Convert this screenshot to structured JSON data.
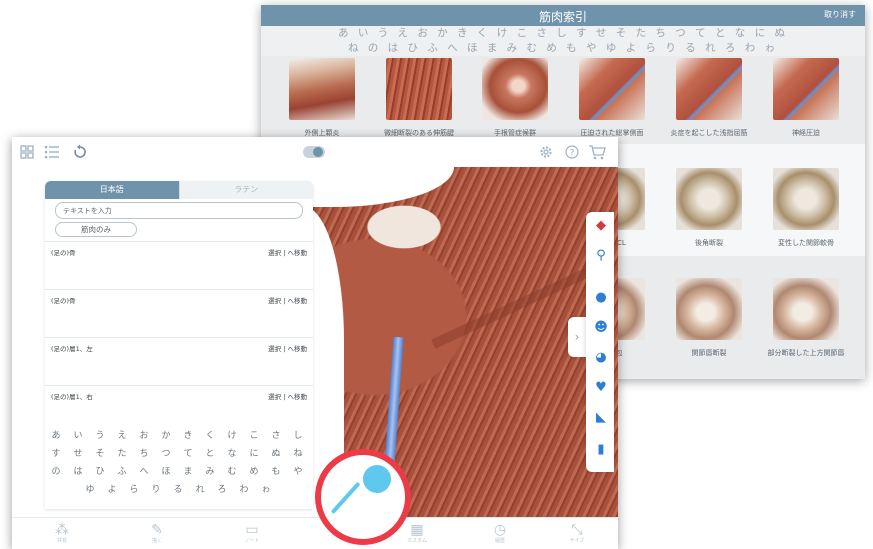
{
  "index_window": {
    "title": "筋肉索引",
    "cancel_label": "取り消す",
    "kana_row1": "あ い う え お か き く け こ さ し す せ そ た ち つ て と な に ぬ",
    "kana_row2": "ね の は ひ ふ へ ほ ま み む め も や ゆ よ ら り る れ ろ わ ゎ",
    "thumbnails": [
      {
        "caption": "外側上顆炎",
        "icon": "forearm-muscle-image"
      },
      {
        "caption": "微細断裂のある伸筋腱",
        "icon": "extensor-tendon-image"
      },
      {
        "caption": "手根管症候群",
        "icon": "hand-image"
      },
      {
        "caption": "圧迫された総掌側面",
        "icon": "forearm-nerve-image"
      },
      {
        "caption": "炎症を起こした浅指屈筋",
        "icon": "forearm-nerve-image"
      },
      {
        "caption": "神経圧迫",
        "icon": "forearm-nerve-image"
      },
      {
        "caption": "したACL",
        "icon": "knee-joint-image"
      },
      {
        "caption": "後角断裂",
        "icon": "knee-joint-image"
      },
      {
        "caption": "変性した関節軟骨",
        "icon": "knee-joint-image"
      },
      {
        "caption": "関節包",
        "icon": "shoulder-joint-image"
      },
      {
        "caption": "関節唇断裂",
        "icon": "shoulder-joint-image"
      },
      {
        "caption": "部分断裂した上方関節唇",
        "icon": "shoulder-joint-image"
      }
    ]
  },
  "app": {
    "top_icons": [
      "grid-icon",
      "list-icon",
      "reset-icon",
      "toggle-icon",
      "settings-icon",
      "help-icon",
      "cart-icon"
    ],
    "panel": {
      "tab_japanese": "日本語",
      "tab_latin": "ラテン",
      "search_placeholder": "テキストを入力",
      "muscle_only_label": "筋肉のみ",
      "results": [
        {
          "name": "(足の)骨",
          "action": "選択 | へ移動"
        },
        {
          "name": "(足の)骨",
          "action": "選択 | へ移動"
        },
        {
          "name": "(足の)層1、左",
          "action": "選択 | へ移動"
        },
        {
          "name": "(足の)層1、右",
          "action": "選択 | へ移動"
        }
      ]
    },
    "keyboard_rows": [
      [
        "あ",
        "い",
        "う",
        "え",
        "お",
        "か",
        "き",
        "く",
        "け",
        "こ",
        "さ",
        "し"
      ],
      [
        "す",
        "せ",
        "そ",
        "た",
        "ち",
        "つ",
        "て",
        "と",
        "な",
        "に",
        "ぬ",
        "ね"
      ],
      [
        "の",
        "は",
        "ひ",
        "ふ",
        "へ",
        "ほ",
        "ま",
        "み",
        "む",
        "め",
        "も",
        "や"
      ],
      [
        "ゆ",
        "よ",
        "ら",
        "り",
        "る",
        "れ",
        "ろ",
        "わ",
        "ゎ"
      ]
    ],
    "right_strip_icons": [
      "layers-icon",
      "pin-icon",
      "head-icon",
      "skull-icon",
      "brain-icon",
      "heart-icon",
      "arm-icon",
      "leg-icon"
    ],
    "bottom_tabs": [
      {
        "icon": "share-icon",
        "label": "共有"
      },
      {
        "icon": "pencil-icon",
        "label": "描く"
      },
      {
        "icon": "document-icon",
        "label": "ノート"
      },
      {
        "icon": "index-icon",
        "label": "索引"
      },
      {
        "icon": "grid-icon",
        "label": "カスタム"
      },
      {
        "icon": "clock-icon",
        "label": "履歴"
      },
      {
        "icon": "resize-icon",
        "label": "サイズ"
      }
    ]
  },
  "colors": {
    "header_blue": "#6f93ab",
    "highlight_red": "#ec3b47",
    "pin_cyan": "#5fc8ee"
  }
}
